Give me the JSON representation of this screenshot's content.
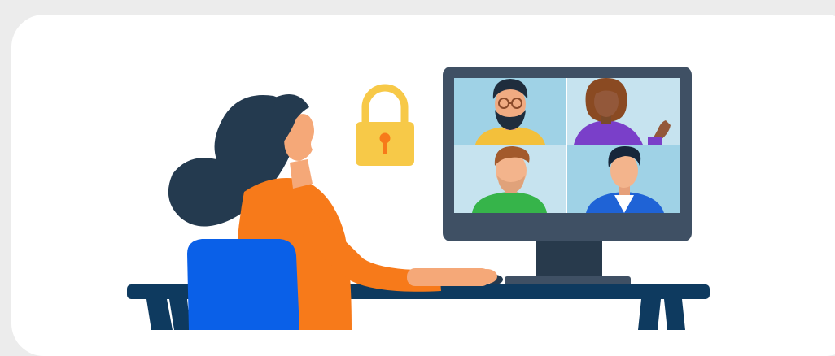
{
  "illustration": {
    "subject": "secure-video-conference",
    "icons": [
      "lock-icon"
    ],
    "participants": [
      {
        "slot": "top-left",
        "role": "participant"
      },
      {
        "slot": "top-right",
        "role": "participant"
      },
      {
        "slot": "bottom-left",
        "role": "participant"
      },
      {
        "slot": "bottom-right",
        "role": "participant"
      }
    ],
    "colors": {
      "background": "#ececec",
      "card": "#ffffff",
      "navy": "#0e3a5f",
      "monitor": "#3f5064",
      "screen_tile_a": "#9fd2e6",
      "screen_tile_b": "#c6e3ef",
      "lock": "#f7c948",
      "shirt": "#f77a1a",
      "chair": "#0a60e8",
      "hair": "#243a4f",
      "skin": "#f5a878"
    }
  }
}
